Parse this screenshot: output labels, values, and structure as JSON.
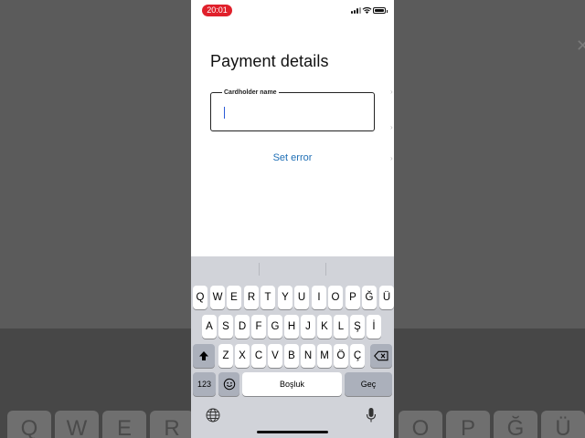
{
  "status_bar": {
    "time": "20:01"
  },
  "page": {
    "title": "Payment details",
    "cardholder_field": {
      "label": "Cardholder name",
      "value": ""
    },
    "set_error_label": "Set error"
  },
  "keyboard": {
    "row1": [
      "Q",
      "W",
      "E",
      "R",
      "T",
      "Y",
      "U",
      "I",
      "O",
      "P",
      "Ğ",
      "Ü"
    ],
    "row2": [
      "A",
      "S",
      "D",
      "F",
      "G",
      "H",
      "J",
      "K",
      "L",
      "Ş",
      "İ"
    ],
    "row3": [
      "Z",
      "X",
      "C",
      "V",
      "B",
      "N",
      "M",
      "Ö",
      "Ç"
    ],
    "numbers_label": "123",
    "space_label": "Boşluk",
    "return_label": "Geç"
  },
  "background_keys": [
    "Q",
    "W",
    "E",
    "R",
    "O",
    "P",
    "Ğ",
    "Ü"
  ],
  "colors": {
    "accent": "#1f6fb5",
    "time_pill": "#e0202b",
    "keyboard_bg": "#d1d3d9"
  }
}
